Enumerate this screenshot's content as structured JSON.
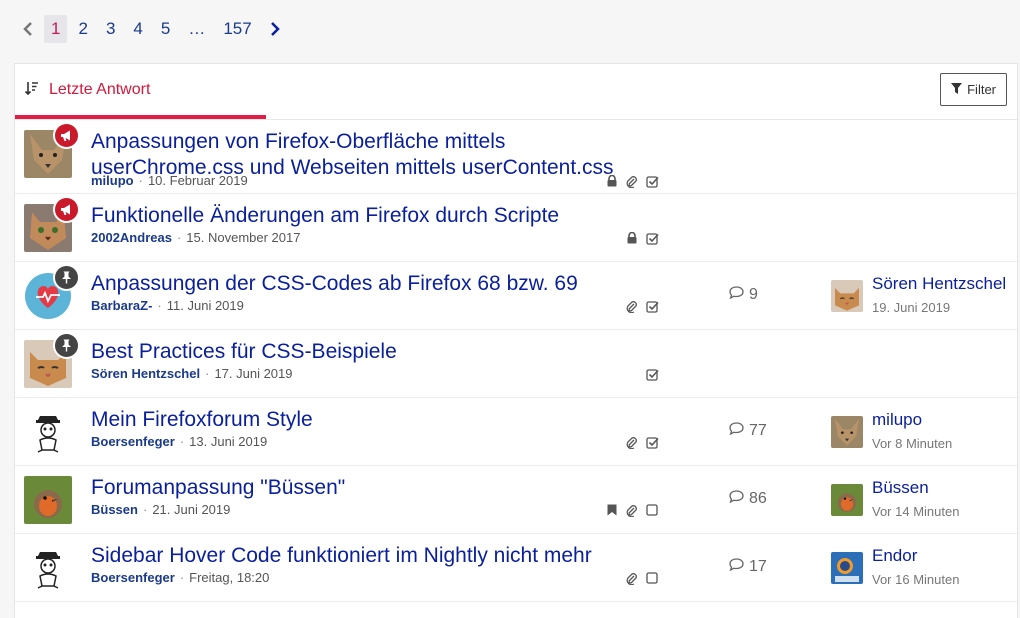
{
  "pagination": {
    "pages": [
      "1",
      "2",
      "3",
      "4",
      "5"
    ],
    "ellipsis": "…",
    "last": "157",
    "active": "1"
  },
  "sort": {
    "label": "Letzte Antwort"
  },
  "filter": {
    "label": "Filter"
  },
  "threads": [
    {
      "title": "Anpassungen von Firefox-Oberfläche mittels userChrome.css und Webseiten mittels userContent.css",
      "author": "milupo",
      "date": "10. Februar 2019",
      "badge": "announcement",
      "icons": [
        "lock-icon",
        "paperclip-icon",
        "check-square-icon"
      ],
      "replies": "",
      "last_user": "",
      "last_time": "",
      "avatar": "fox",
      "accent": "#8a6b47"
    },
    {
      "title": "Funktionelle Änderungen am Firefox durch Scripte",
      "author": "2002Andreas",
      "date": "15. November 2017",
      "badge": "announcement",
      "icons": [
        "lock-icon",
        "check-square-icon"
      ],
      "replies": "",
      "last_user": "",
      "last_time": "",
      "avatar": "cat",
      "accent": "#b08056"
    },
    {
      "title": "Anpassungen der CSS-Codes ab Firefox 68 bzw. 69",
      "author": "BarbaraZ-",
      "date": "11. Juni 2019",
      "badge": "sticky",
      "icons": [
        "paperclip-icon",
        "check-square-icon"
      ],
      "replies": "9",
      "last_user": "Sören Hentzschel",
      "last_time": "19. Juni 2019",
      "avatar": "heart",
      "accent": "#5cb4d8"
    },
    {
      "title": "Best Practices für CSS-Beispiele",
      "author": "Sören Hentzschel",
      "date": "17. Juni 2019",
      "badge": "sticky",
      "icons": [
        "check-square-icon"
      ],
      "replies": "",
      "last_user": "",
      "last_time": "",
      "avatar": "cat2",
      "accent": "#c98a4e"
    },
    {
      "title": "Mein Firefoxforum Style",
      "author": "Boersenfeger",
      "date": "13. Juni 2019",
      "badge": "",
      "icons": [
        "paperclip-icon",
        "check-square-icon"
      ],
      "replies": "77",
      "last_user": "milupo",
      "last_time": "Vor 8 Minuten",
      "avatar": "sketch",
      "accent": "#ffffff"
    },
    {
      "title": "Forumanpassung \"Büssen\"",
      "author": "Büssen",
      "date": "21. Juni 2019",
      "badge": "",
      "icons": [
        "bookmark-icon",
        "paperclip-icon",
        "square-icon"
      ],
      "replies": "86",
      "last_user": "Büssen",
      "last_time": "Vor 14 Minuten",
      "avatar": "robin",
      "accent": "#5f7a3a"
    },
    {
      "title": "Sidebar Hover Code funktioniert im Nightly nicht mehr",
      "author": "Boersenfeger",
      "date": "Freitag, 18:20",
      "badge": "",
      "icons": [
        "paperclip-icon",
        "square-icon"
      ],
      "replies": "17",
      "last_user": "Endor",
      "last_time": "Vor 16 Minuten",
      "avatar": "sketch",
      "accent": "#ffffff"
    }
  ],
  "last_avatars": [
    "",
    "",
    "cat2",
    "",
    "fox",
    "robin",
    "endor"
  ]
}
